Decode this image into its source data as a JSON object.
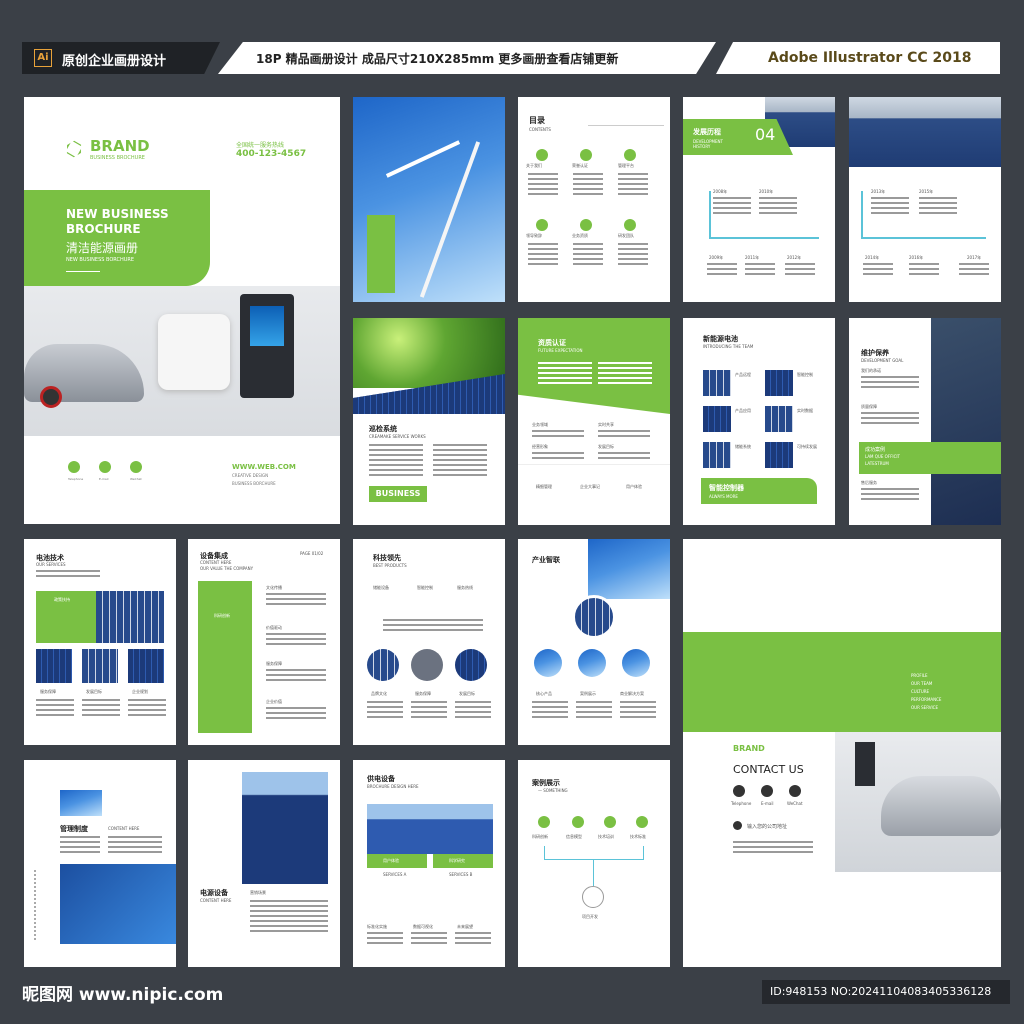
{
  "header": {
    "ai_badge": "Ai",
    "left_title": "原创企业画册设计",
    "center_title": "18P 精品画册设计 成品尺寸210X285mm 更多画册查看店铺更新",
    "right_title": "Adobe Illustrator CC 2018"
  },
  "cover": {
    "brand": "BRAND",
    "brand_sub": "BUSINESS BROCHURE",
    "hotline_label": "全国统一服务热线",
    "phone": "400-123-4567",
    "headline1": "NEW BUSINESS",
    "headline2": "BROCHURE",
    "cn_title": "清洁能源画册",
    "sub": "NEW BUSINESS BORCHURE",
    "web": "WWW.WEB.COM",
    "web_sub1": "CREATIVE DESIGN",
    "web_sub2": "BUSINESS BORCHURE",
    "icon_labels": [
      "Telephone",
      "E-mail",
      "WeChat"
    ]
  },
  "p_toc": {
    "title": "目录",
    "sub": "CONTENTS",
    "items": [
      "关于我们",
      "荣誉认证",
      "管理平台",
      "领导致辞",
      "业务资质",
      "研发团队"
    ]
  },
  "p_history": {
    "title": "发展历程",
    "sub": "DEVELOPMENT HISTORY",
    "number": "04",
    "years_top": [
      "2008年",
      "2010年"
    ],
    "years_bottom": [
      "2009年",
      "2011年",
      "2012年"
    ],
    "years_top2": [
      "2013年",
      "2015年"
    ],
    "years_bottom2": [
      "2014年",
      "2016年",
      "2017年"
    ]
  },
  "p_inspect": {
    "title": "巡检系统",
    "sub": "CREAMAKE SERVICE WORKS",
    "badge": "BUSINESS"
  },
  "p_qual": {
    "title": "资质认证",
    "sub": "FUTURE EXPECTATION",
    "items": [
      "业务领域",
      "实时共享",
      "经营形象",
      "发展目标"
    ],
    "icons": [
      "精细管理",
      "企业大事记",
      "用户体验"
    ]
  },
  "p_battery": {
    "title": "新能源电池",
    "sub": "INTRODUCING THE TEAM",
    "labels": [
      "产品远程",
      "智能控制",
      "产品应用",
      "实时数据",
      "储能系统",
      "可持续发展"
    ],
    "banner": "智能控制器",
    "banner_sub": "ALWAYS MORE"
  },
  "p_maint": {
    "title": "维护保养",
    "sub": "DEVELOPMENT GOAL",
    "labels": [
      "我们的承诺",
      "质量保障",
      "售后服务"
    ],
    "box_title": "成功案例",
    "box_sub1": "LAM QUE OFFICIT",
    "box_sub2": "LATESTRUM"
  },
  "p_tech": {
    "title": "电池技术",
    "sub": "OUR SERVICES",
    "box": "政策扶持",
    "labels": [
      "服务保障",
      "发展目标",
      "企业规划"
    ]
  },
  "p_equip": {
    "title": "设备集成",
    "sub": "CONTENT HERE",
    "sub2": "OUR VALUE THE COMPANY",
    "page": "PAGE 01/02",
    "side": "科研创新",
    "items": [
      "文化传播",
      "价值驱动",
      "服务保障",
      "企业价值"
    ]
  },
  "p_lead": {
    "title": "科技领先",
    "sub": "BEST PRODUCTS",
    "icons": [
      "储能设备",
      "智能控制",
      "服务热线"
    ],
    "labels": [
      "品牌文化",
      "服务保障",
      "发展目标"
    ]
  },
  "p_industry": {
    "title": "产业智联",
    "labels": [
      "核心产品",
      "案例展示",
      "商业解决方案"
    ]
  },
  "p_green": {
    "menu": [
      "PROFILE",
      "OUR TEAM",
      "CULTURE",
      "PERFORMANCE",
      "OUR SERVICE"
    ]
  },
  "p_mgmt": {
    "title": "管理制度",
    "sub": "CONTENT HERE"
  },
  "p_power": {
    "title": "电源设备",
    "sub": "CONTENT HERE",
    "label": "营销场景"
  },
  "p_supply": {
    "title": "供电设备",
    "sub": "BROCHURE DESIGN HERE",
    "tags": [
      "用户体验",
      "科学研究"
    ],
    "services": [
      "SERVICES A",
      "SERVICES B"
    ],
    "labels": [
      "标准化实施",
      "数据可视化",
      "未来展望"
    ]
  },
  "p_case": {
    "title": "案例展示",
    "sub": "— SOMETHING",
    "items": [
      "科研创新",
      "信息模型",
      "技术培训",
      "技术标准"
    ],
    "center": "项目开发"
  },
  "p_contact": {
    "brand": "BRAND",
    "title": "CONTACT US",
    "address": "输入您的公司地址",
    "icon_labels": [
      "Telephone",
      "E-mail",
      "WeChat"
    ]
  },
  "footer": {
    "logo": "昵图网 www.nipic.com",
    "id": "ID:948153 NO:20241104083405336128"
  }
}
